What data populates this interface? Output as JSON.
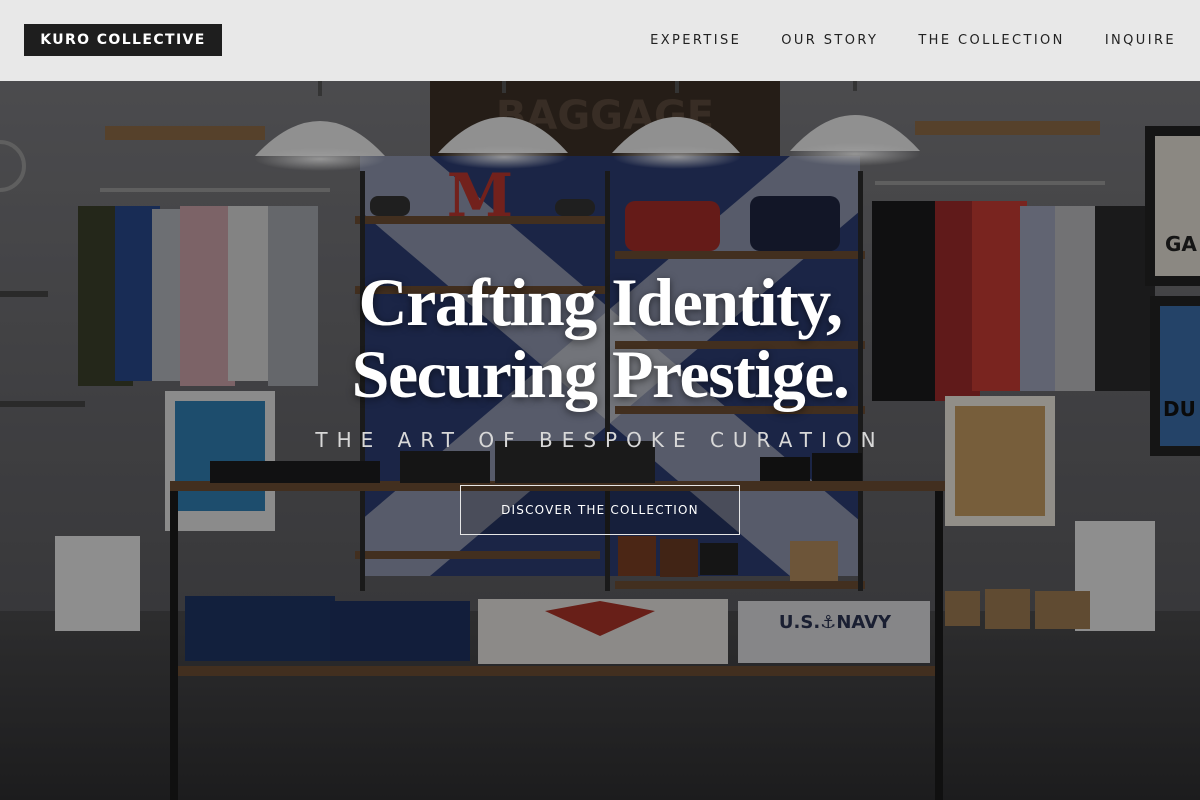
{
  "header": {
    "logo_text": "KURO COLLECTIVE",
    "nav": [
      {
        "label": "EXPERTISE"
      },
      {
        "label": "OUR STORY"
      },
      {
        "label": "THE COLLECTION"
      },
      {
        "label": "INQUIRE"
      }
    ]
  },
  "hero": {
    "headline_line1": "Crafting Identity,",
    "headline_line2": "Securing Prestige.",
    "tagline": "THE ART OF BESPOKE CURATION",
    "cta_label": "DISCOVER THE COLLECTION",
    "background_image": "clothing-store-interior-photo"
  },
  "colors": {
    "header_bg": "#e8e8e8",
    "logo_bg": "#1e1e1e",
    "hero_text": "#ffffff",
    "cta_border": "#e6e6e6"
  }
}
